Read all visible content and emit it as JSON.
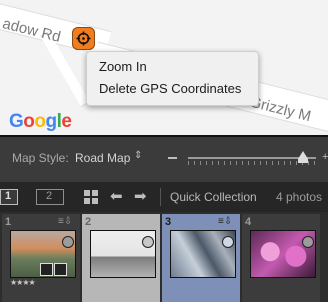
{
  "map": {
    "roads": {
      "road1": "adow Rd",
      "road2": "Rd Grizzly M"
    },
    "logo": "Google"
  },
  "context_menu": {
    "items": [
      "Zoom In",
      "Delete GPS Coordinates"
    ]
  },
  "map_toolbar": {
    "style_label": "Map Style:",
    "style_value": "Road Map"
  },
  "filmstrip_bar": {
    "view_1": "1",
    "view_2": "2",
    "source": "Quick Collection",
    "count": "4 photos"
  },
  "filmstrip": {
    "cells": [
      {
        "number": "1",
        "rating": "★★★★"
      },
      {
        "number": "2"
      },
      {
        "number": "3"
      },
      {
        "number": "4"
      }
    ]
  },
  "colors": {
    "pin": "#f07d1f",
    "selected_cell": "#7f90b8",
    "cell_light": "#b7b7b7"
  }
}
